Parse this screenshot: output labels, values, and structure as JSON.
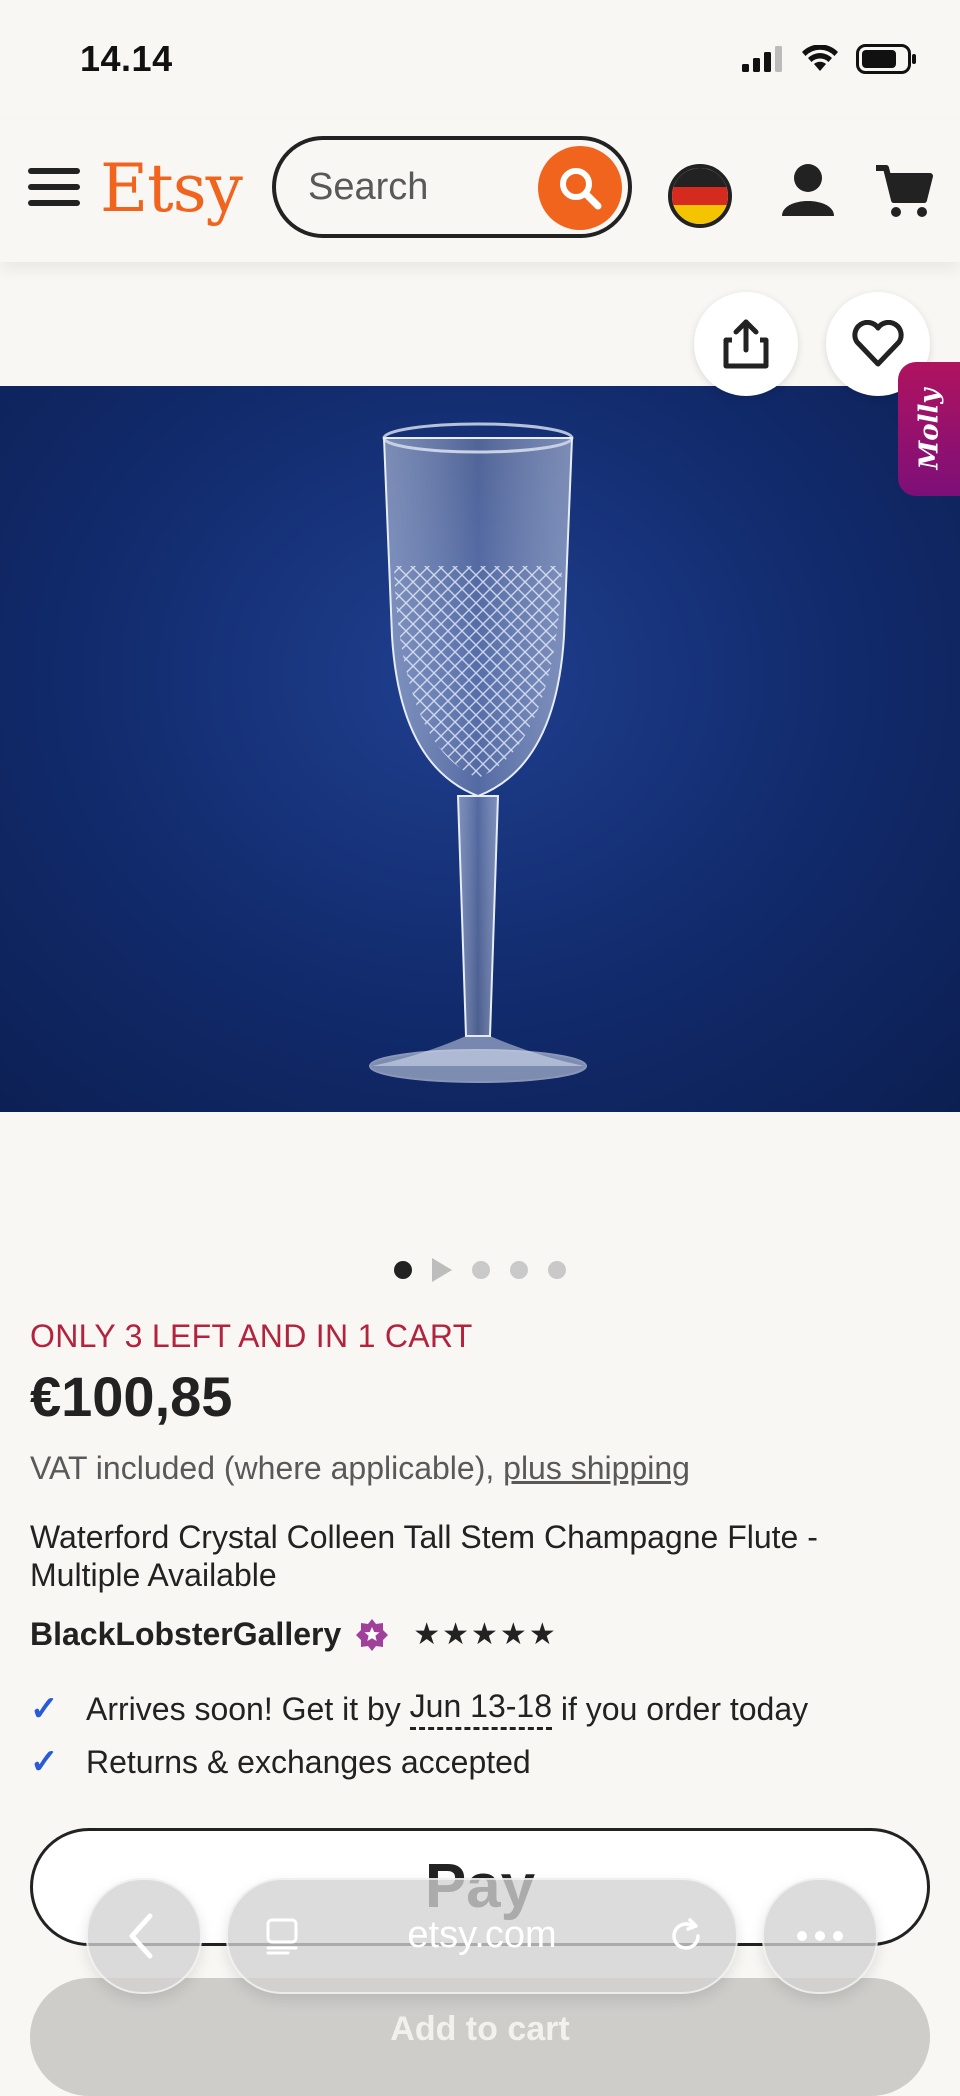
{
  "status_bar": {
    "time": "14.14"
  },
  "header": {
    "logo": "Etsy",
    "search_placeholder": "Search"
  },
  "product": {
    "stock_notice": "ONLY 3 LEFT AND IN 1 CART",
    "price": "€100,85",
    "vat_text": "VAT included (where applicable),",
    "shipping_link": "plus shipping",
    "title": "Waterford Crystal Colleen Tall Stem Champagne Flute - Multiple Available",
    "shop_name": "BlackLobsterGallery",
    "rating_stars": "★★★★★",
    "image_dots": {
      "count": 5,
      "active_index": 0,
      "video_index": 1
    }
  },
  "benefits": {
    "arrival_prefix": "Arrives soon! Get it by",
    "arrival_dates": "Jun 13-18",
    "arrival_suffix": "if you order today",
    "returns": "Returns & exchanges accepted"
  },
  "buttons": {
    "apple_pay": "Pay",
    "add_to_cart": "Add to cart"
  },
  "side_tab": {
    "label": "Molly"
  },
  "browser": {
    "url": "etsy.com"
  },
  "colors": {
    "brand_orange": "#f1641e",
    "stock_red": "#b3233e",
    "check_blue": "#2a5bd7",
    "photo_blue": "#112a6b"
  }
}
